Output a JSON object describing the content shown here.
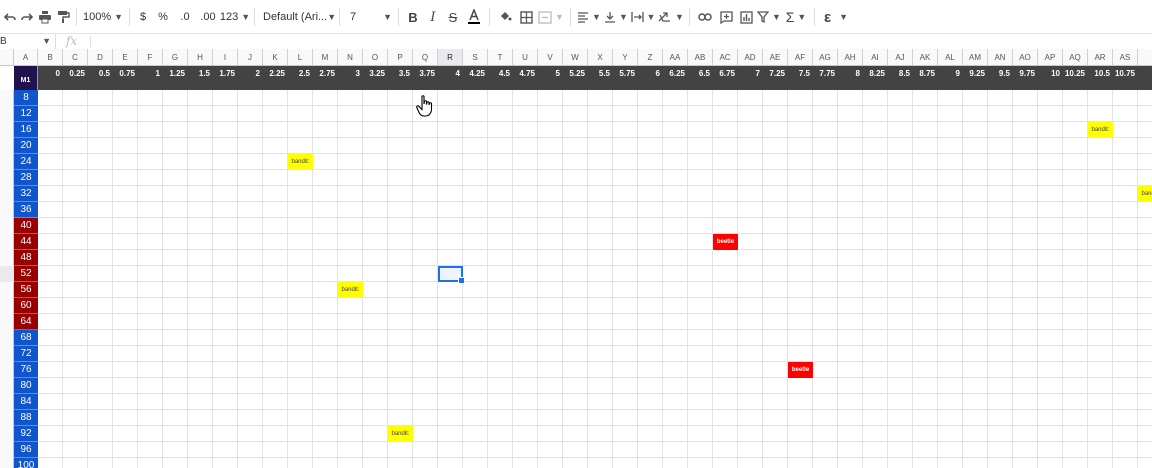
{
  "toolbar": {
    "zoom": "100%",
    "currency": "$",
    "percent": "%",
    "decrease_decimal": ".0",
    "increase_decimal": ".00",
    "format": "123",
    "font": "Default (Ari...",
    "font_size": "7"
  },
  "formula_bar": {
    "name_box": "B",
    "fx": "fx",
    "formula": ""
  },
  "columns": [
    "A",
    "B",
    "C",
    "D",
    "E",
    "F",
    "G",
    "H",
    "I",
    "J",
    "K",
    "L",
    "M",
    "N",
    "O",
    "P",
    "Q",
    "R",
    "S",
    "T",
    "U",
    "V",
    "W",
    "X",
    "Y",
    "Z",
    "AA",
    "AB",
    "AC",
    "AD",
    "AE",
    "AF",
    "AG",
    "AH",
    "AI",
    "AJ",
    "AK",
    "AL",
    "AM",
    "AN",
    "AO",
    "AP",
    "AQ",
    "AR",
    "AS",
    ""
  ],
  "selected_column": "R",
  "header_label": "M1",
  "header_values": [
    "0",
    "0.25",
    "0.5",
    "0.75",
    "1",
    "1.25",
    "1.5",
    "1.75",
    "2",
    "2.25",
    "2.5",
    "2.75",
    "3",
    "3.25",
    "3.5",
    "3.75",
    "4",
    "4.25",
    "4.5",
    "4.75",
    "5",
    "5.25",
    "5.5",
    "5.75",
    "6",
    "6.25",
    "6.5",
    "6.75",
    "7",
    "7.25",
    "7.5",
    "7.75",
    "8",
    "8.25",
    "8.5",
    "8.75",
    "9",
    "9.25",
    "9.5",
    "9.75",
    "10",
    "10.25",
    "10.5",
    "10.75"
  ],
  "rows": [
    "8",
    "12",
    "16",
    "20",
    "24",
    "28",
    "32",
    "36",
    "40",
    "44",
    "48",
    "52",
    "56",
    "60",
    "64",
    "68",
    "72",
    "76",
    "80",
    "84",
    "88",
    "92",
    "96",
    "100"
  ],
  "row_colors": {
    "blue": "#1155cc",
    "red": "#990000"
  },
  "red_rows": [
    "40",
    "44",
    "48",
    "52",
    "56",
    "60",
    "64"
  ],
  "bandit_label": "bandit:",
  "beetle_label": "beetle",
  "markers": [
    {
      "label": "bandit:",
      "kind": "bandit",
      "column": "AR",
      "row": "16"
    },
    {
      "label": "bandit:",
      "kind": "bandit",
      "column": "L",
      "row": "24"
    },
    {
      "label": "bandit:",
      "kind": "bandit",
      "column": "",
      "row": "32"
    },
    {
      "label": "beetle",
      "kind": "beetle",
      "column": "AC",
      "row": "44"
    },
    {
      "label": "bandit:",
      "kind": "bandit",
      "column": "N",
      "row": "56"
    },
    {
      "label": "beetle",
      "kind": "beetle",
      "column": "AF",
      "row": "76"
    },
    {
      "label": "bandit:",
      "kind": "bandit",
      "column": "P",
      "row": "92"
    }
  ],
  "selected_cell": {
    "column": "R",
    "row": "52"
  },
  "colors": {
    "header_bar": "#434343",
    "m1_cell": "#20124d",
    "bandit": "#ffff00",
    "beetle": "#ff0000",
    "selection": "#1a73e8"
  }
}
